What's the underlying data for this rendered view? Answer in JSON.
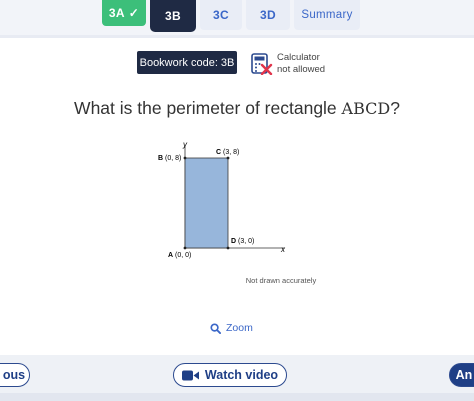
{
  "tabs": [
    {
      "label": "3A",
      "state": "done"
    },
    {
      "label": "3B",
      "state": "active"
    },
    {
      "label": "3C",
      "state": "plain"
    },
    {
      "label": "3D",
      "state": "plain"
    },
    {
      "label": "Summary",
      "state": "plain"
    }
  ],
  "bookwork": {
    "label": "Bookwork code: 3B"
  },
  "calculator": {
    "line1": "Calculator",
    "line2": "not allowed"
  },
  "question": {
    "prefix": "What is the perimeter of rectangle ",
    "shape": "ABCD",
    "suffix": "?"
  },
  "diagram": {
    "axis_y": "y",
    "axis_x": "x",
    "points": [
      {
        "name": "A",
        "coords": "(0, 0)"
      },
      {
        "name": "B",
        "coords": "(0, 8)"
      },
      {
        "name": "C",
        "coords": "(3, 8)"
      },
      {
        "name": "D",
        "coords": "(3, 0)"
      }
    ],
    "fill_color": "#97b6db",
    "caption": "Not drawn accurately"
  },
  "zoom": {
    "label": "Zoom"
  },
  "footer": {
    "previous_label": "ous",
    "watch_label": "Watch video",
    "answer_label": "An"
  },
  "colors": {
    "accent": "#3b67c8",
    "dark": "#1f2a44",
    "done": "#3cbf7a"
  }
}
